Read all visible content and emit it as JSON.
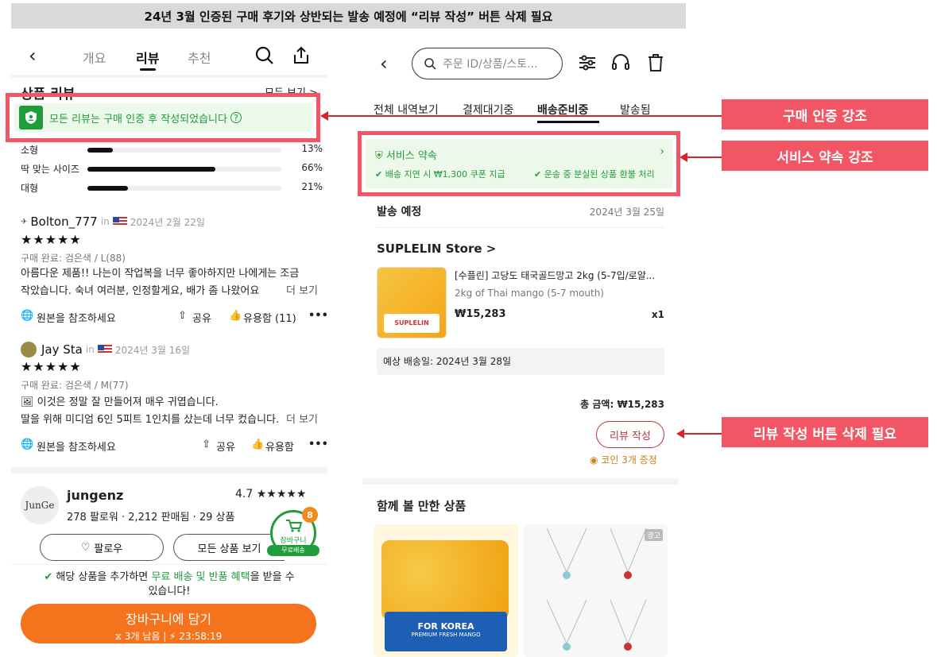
{
  "banner": "24년 3월 인증된 구매 후기와 상반되는 발송 예정에 “리뷰 작성” 버튼 삭제 필요",
  "left": {
    "tabs": [
      "개요",
      "리뷰",
      "추천"
    ],
    "section_title": "상품 리뷰",
    "see_all": "모두 보기 >",
    "verify_text": "모든 리뷰는 구매 인증 후 작성되었습니다",
    "sizes": [
      {
        "label": "소형",
        "pct": "13%",
        "fill": 0.13
      },
      {
        "label": "딱 맞는 사이즈",
        "pct": "66%",
        "fill": 0.66
      },
      {
        "label": "대형",
        "pct": "21%",
        "fill": 0.21
      }
    ],
    "reviews": [
      {
        "user": "Bolton_777",
        "in": "in",
        "date": "2024년 2월 22일",
        "stars": "★★★★★",
        "option": "구매 완료: 검은색 / L(88)",
        "text1": "아름다운 제품!! 나는이 작업복을 너무 좋아하지만 나에게는 조금",
        "text2": "작았습니다. 숙녀 여러분, 인정할게요, 배가 좀 나왔어요.",
        "more": "더 보기",
        "source": "원본을 참조하세요",
        "share": "공유",
        "helpful": "유용함 (11)"
      },
      {
        "user": "Jay Sta",
        "in": "in",
        "date": "2024년 3월 16일",
        "stars": "★★★★★",
        "option": "구매 완료: 검은색 / M(77)",
        "text1": "이것은 정말 잘 만들어져 매우 귀엽습니다.",
        "text2": "딸을 위해 미디엄 6인 5피트 1인치를 샀는데 너무 컸습니다.",
        "more": "더 보기",
        "source": "원본을 참조하세요",
        "share": "공유",
        "helpful": "유용함"
      }
    ],
    "store": {
      "name": "jungenz",
      "avatar_text": "JunGe",
      "rating": "4.7",
      "stars": "★★★★★",
      "followers": "278 팔로워",
      "sold": "2,212 판매됨",
      "items": "29 상품"
    },
    "follow": "팔로우",
    "all_items": "모든 상품 보기",
    "cart_badge": "8",
    "cart_label": "장바구니",
    "free_ship": "무료배송",
    "notice_pre": "해당 상품을 추가하면 ",
    "notice_green": "무료 배송 및 반품 혜택",
    "notice_post": "을 받을 수",
    "notice_line2": "있습니다!",
    "add_cart": "장바구니에 담기",
    "remaining": "3개 남음",
    "timer": "23:58:19"
  },
  "right": {
    "search_placeholder": "주문 ID/상품/스토...",
    "tabs": [
      "전체 내역보기",
      "결제대기중",
      "배송준비중",
      "발송됨"
    ],
    "promise_title": "서비스 약속",
    "promise_1": "배송 지연 시 ₩1,300 쿠폰 지급",
    "promise_2": "운송 중 분실된 상품 환불 처리",
    "ship_label": "발송 예정",
    "ship_date": "2024년 3월 25일",
    "store": "SUPLELIN Store >",
    "product_name": "[수플린] 고당도 태국골드망고 2kg (5-7입/로얄...",
    "product_sub": "2kg of Thai mango (5-7 mouth)",
    "price": "₩15,283",
    "qty": "x1",
    "eta": "예상 배송일: 2024년 3월 28일",
    "total": "총 금액: ₩15,283",
    "review_btn": "리뷰 작성",
    "coin": "코인 3개 증정",
    "recommend": "함께 볼 만한 상품",
    "ad": "광고",
    "product_brand": "SUPLELIN",
    "box_title": "FOR KOREA",
    "box_sub": "PREMIUM FRESH MANGO"
  },
  "callouts": [
    "구매 인증 강조",
    "서비스 약속 강조",
    "리뷰 작성 버튼 삭제 필요"
  ],
  "colors": {
    "accent": "#f25563",
    "green": "#1f9d3b",
    "orange": "#f4731c"
  }
}
